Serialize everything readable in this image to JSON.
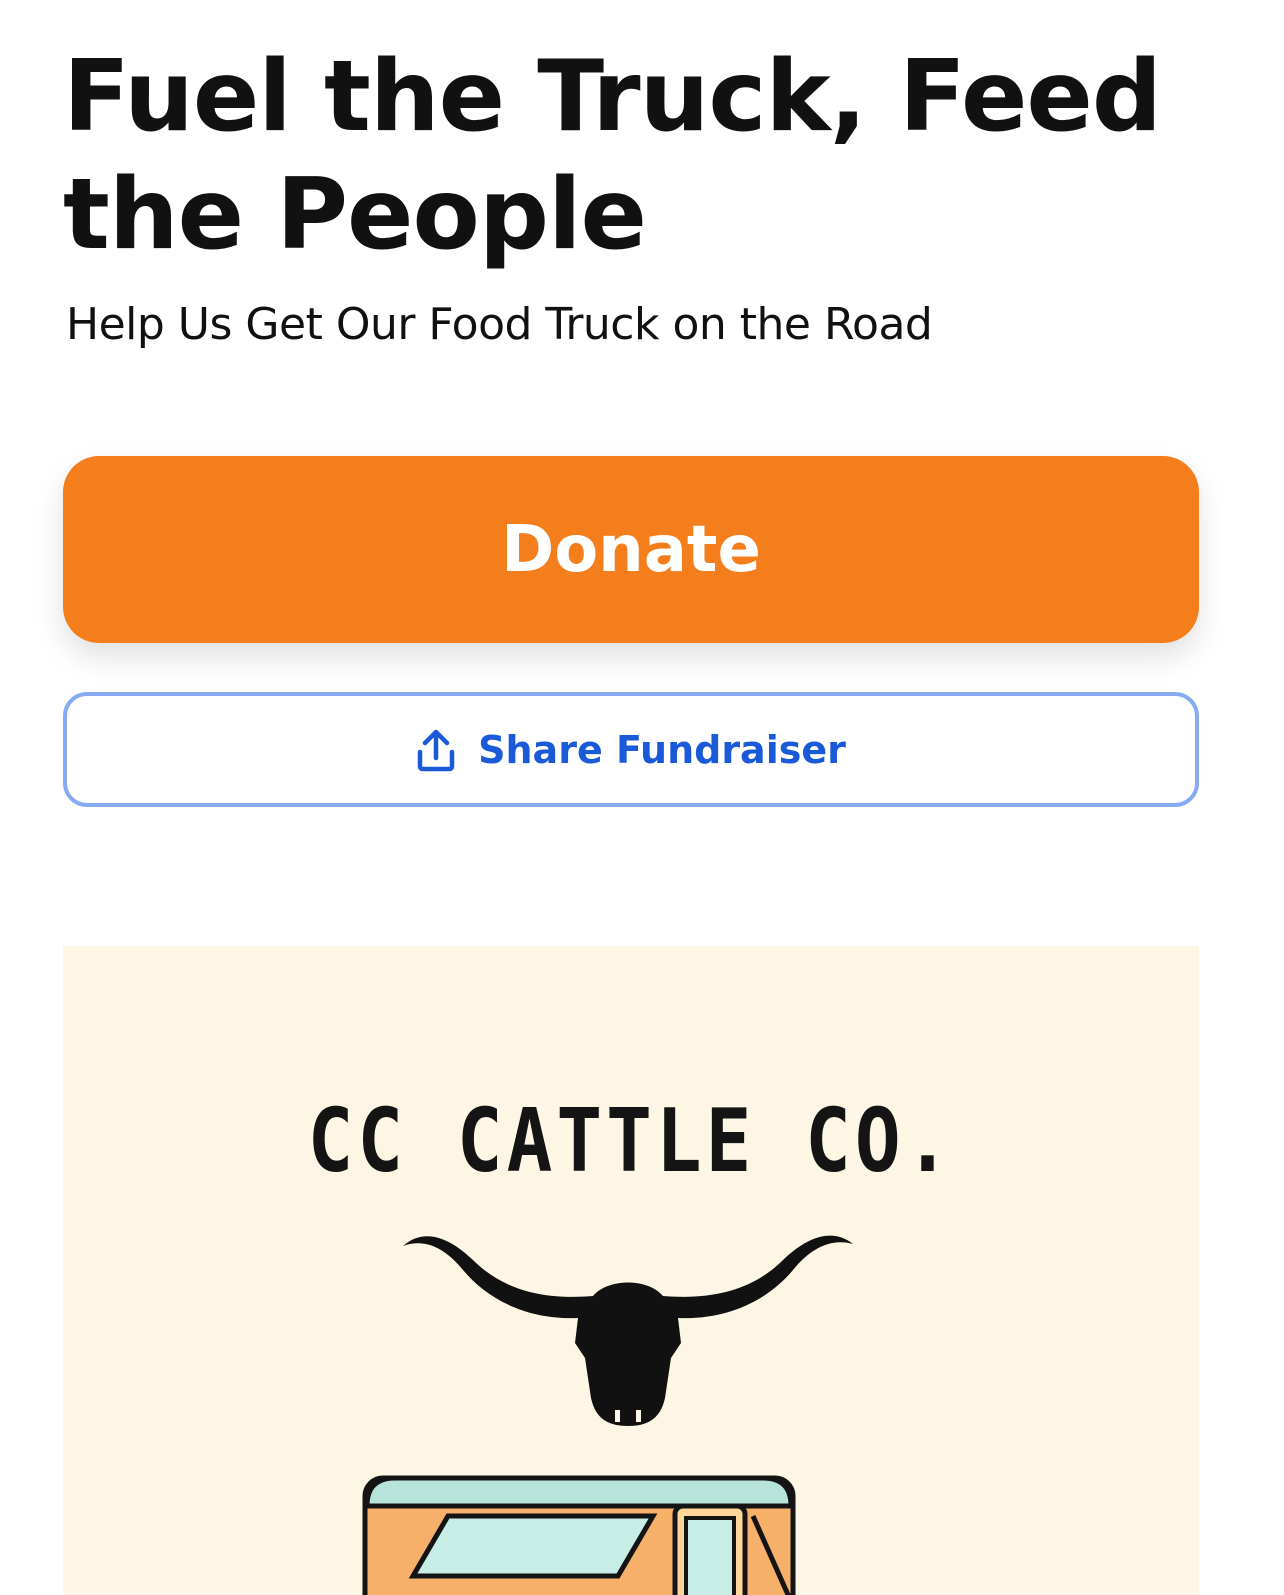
{
  "fundraiser": {
    "title": "Fuel the Truck, Feed the People",
    "subtitle": "Help Us Get Our Food Truck on the Road"
  },
  "actions": {
    "donate_label": "Donate",
    "share_label": "Share Fundraiser",
    "share_icon": "share-upload-icon"
  },
  "hero": {
    "brand_text": "CC CATTLE CO.",
    "background_color": "#fdf6e4"
  },
  "colors": {
    "donate": "#f47d1c",
    "share_text": "#1a5ad8",
    "share_border": "#86abf3"
  }
}
